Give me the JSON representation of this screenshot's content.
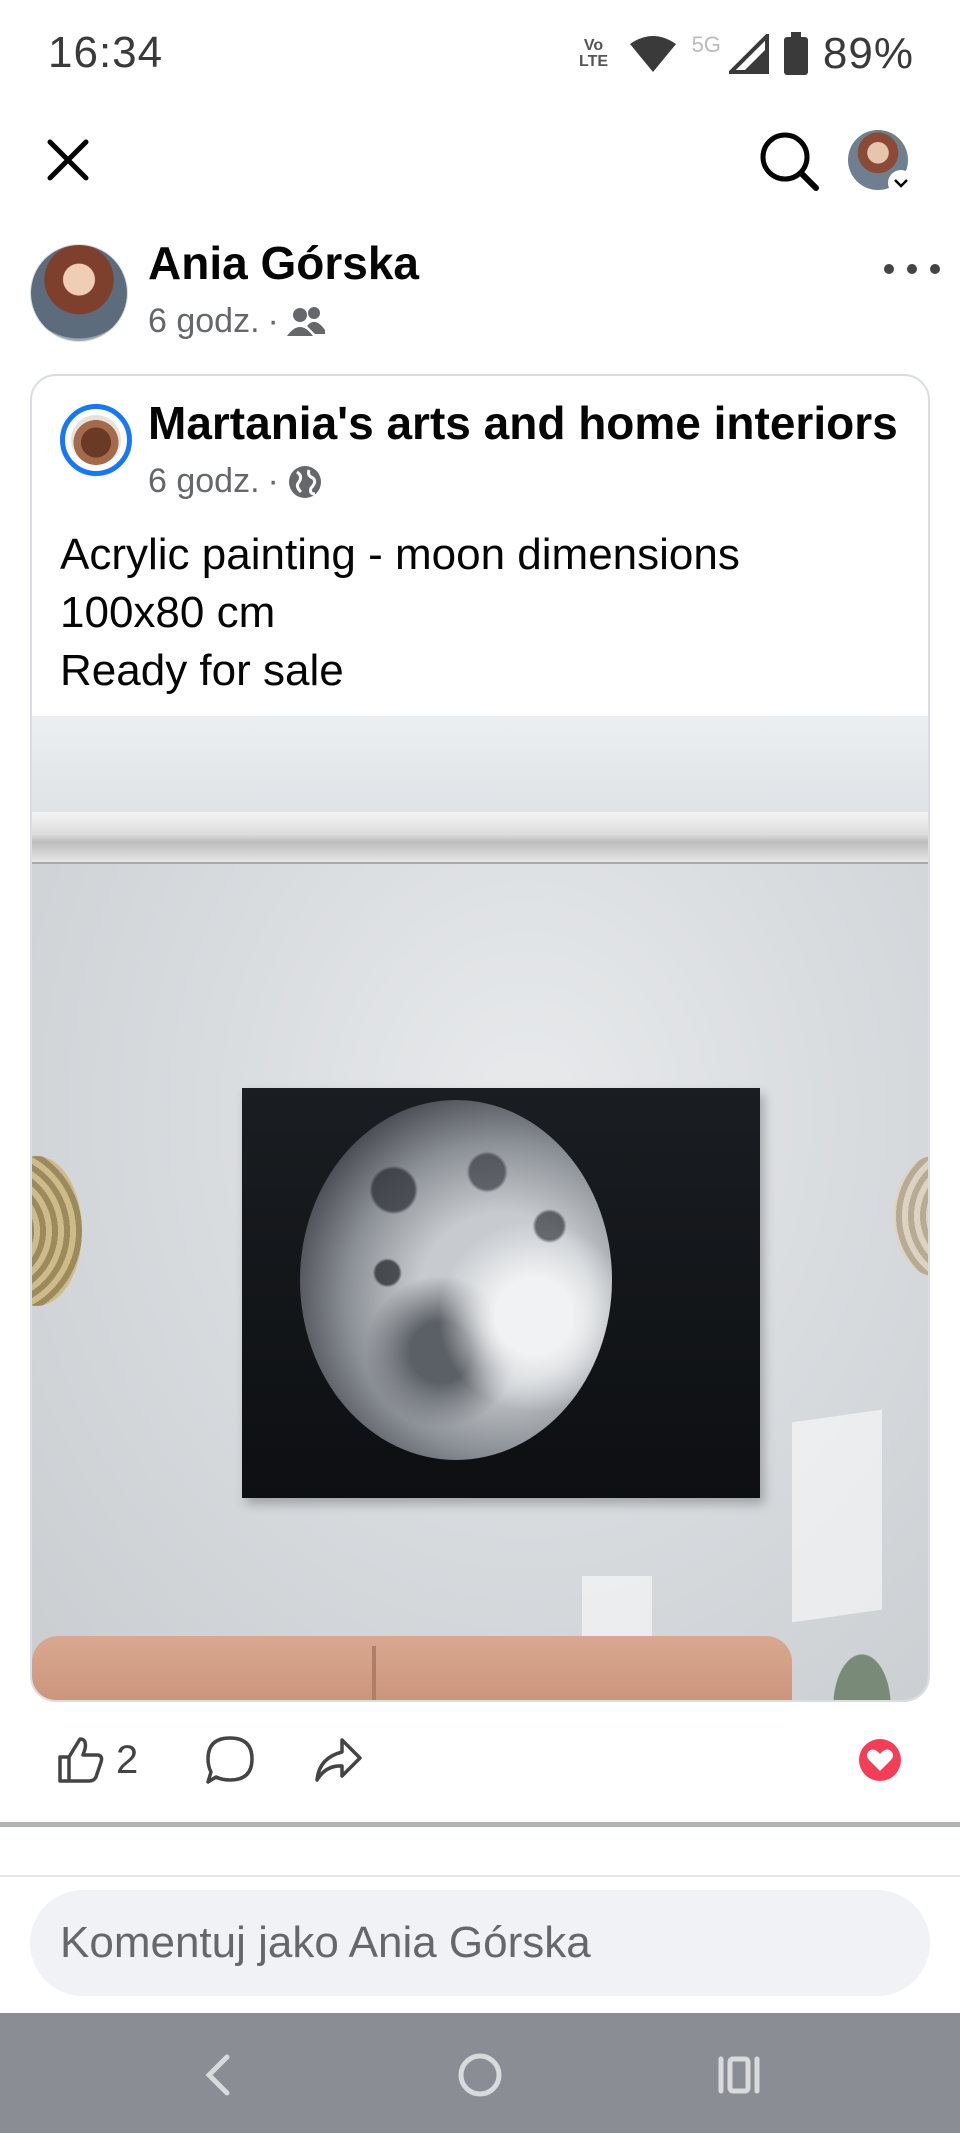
{
  "status_bar": {
    "time": "16:34",
    "volte": "Vo LTE",
    "network": "5G",
    "battery": "89%",
    "icons": [
      "wifi-icon",
      "signal-icon",
      "battery-icon"
    ]
  },
  "top_bar": {
    "icons": [
      "close-icon",
      "search-icon",
      "profile-avatar"
    ]
  },
  "post": {
    "author": "Ania Górska",
    "time": "6 godz.",
    "separator": "·",
    "audience_icon": "friends-icon",
    "shared": {
      "page_name": "Martania's arts and home interiors",
      "time": "6 godz.",
      "separator": "·",
      "audience_icon": "globe-icon",
      "text_line_1": "Acrylic painting - moon dimensions",
      "text_line_2": "100x80 cm",
      "text_line_3": "Ready for sale",
      "image_alt": "Moon painting on wall"
    },
    "actions": {
      "like_count": "2",
      "icons": [
        "like-icon",
        "comment-icon",
        "share-icon",
        "love-reaction-icon"
      ]
    }
  },
  "comment": {
    "placeholder": "Komentuj jako Ania Górska"
  },
  "nav": {
    "icons": [
      "back-icon",
      "home-icon",
      "recents-icon"
    ]
  },
  "colors": {
    "accent": "#1877f2",
    "love": "#f33e58",
    "nav_bg": "#8a8e94"
  }
}
